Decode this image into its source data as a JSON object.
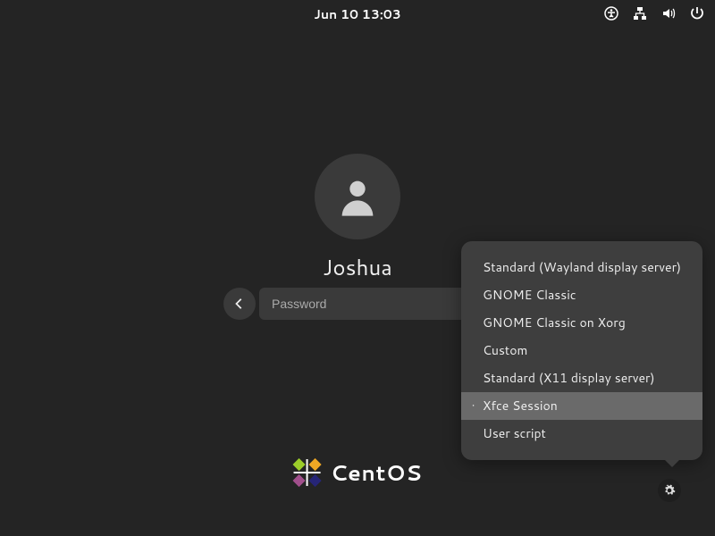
{
  "topbar": {
    "datetime": "Jun 10  13:03"
  },
  "user": {
    "name": "Joshua"
  },
  "password": {
    "placeholder": "Password",
    "value": ""
  },
  "sessions": {
    "items": [
      {
        "label": "Standard (Wayland display server)",
        "selected": false
      },
      {
        "label": "GNOME Classic",
        "selected": false
      },
      {
        "label": "GNOME Classic on Xorg",
        "selected": false
      },
      {
        "label": "Custom",
        "selected": false
      },
      {
        "label": "Standard (X11 display server)",
        "selected": false
      },
      {
        "label": "Xfce Session",
        "selected": true
      },
      {
        "label": "User script",
        "selected": false
      }
    ]
  },
  "branding": {
    "name": "CentOS"
  }
}
